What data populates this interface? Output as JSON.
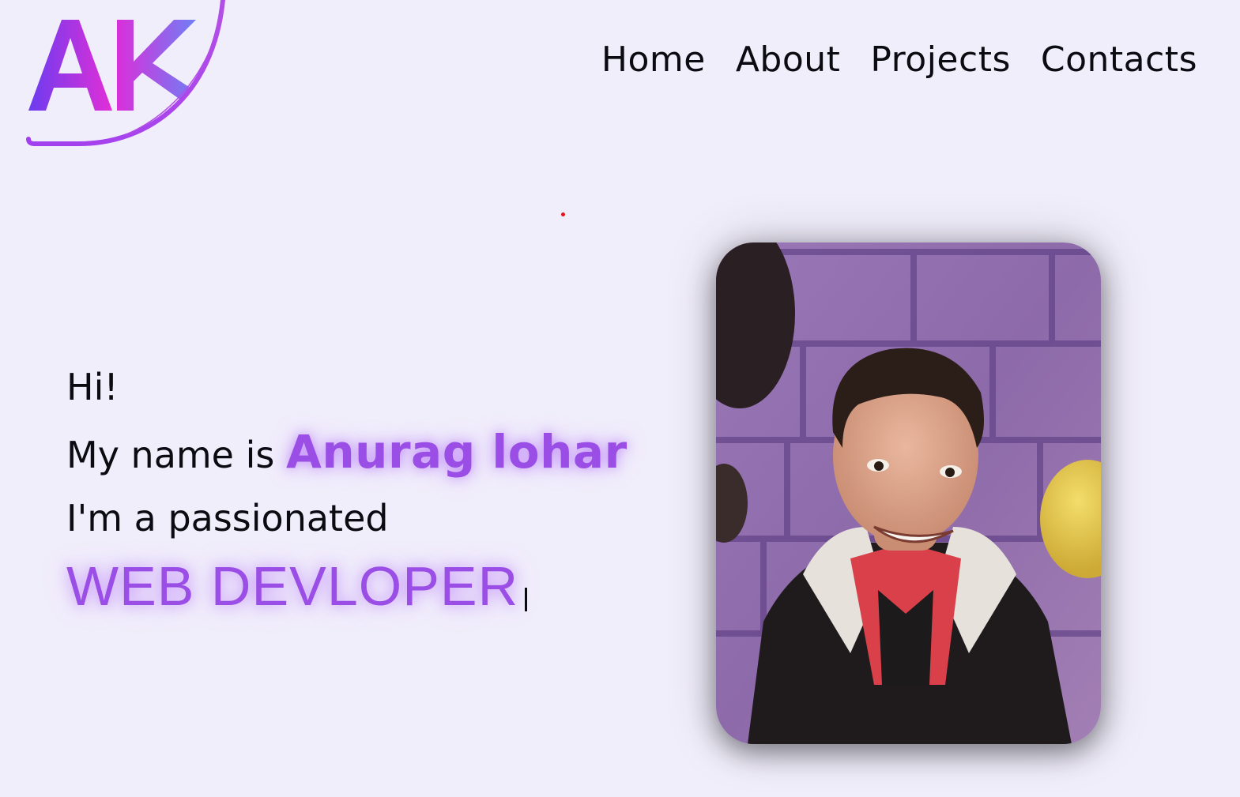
{
  "logo": {
    "text": "AK",
    "gradient_start": "#7c3aed",
    "gradient_mid": "#c026d3",
    "gradient_end": "#6d7cf7"
  },
  "nav": {
    "items": [
      {
        "label": "Home"
      },
      {
        "label": "About"
      },
      {
        "label": "Projects"
      },
      {
        "label": "Contacts"
      }
    ]
  },
  "hero": {
    "greeting": "Hi!",
    "name_prefix": "My name is ",
    "name": "Anurag lohar",
    "tagline": "I'm a passionated",
    "role": "WEB DEVLOPER"
  },
  "profile_photo": {
    "icon": "profile-photo"
  },
  "colors": {
    "background": "#f1eefb",
    "accent": "#9a4ee6",
    "text": "#0b0b12"
  }
}
